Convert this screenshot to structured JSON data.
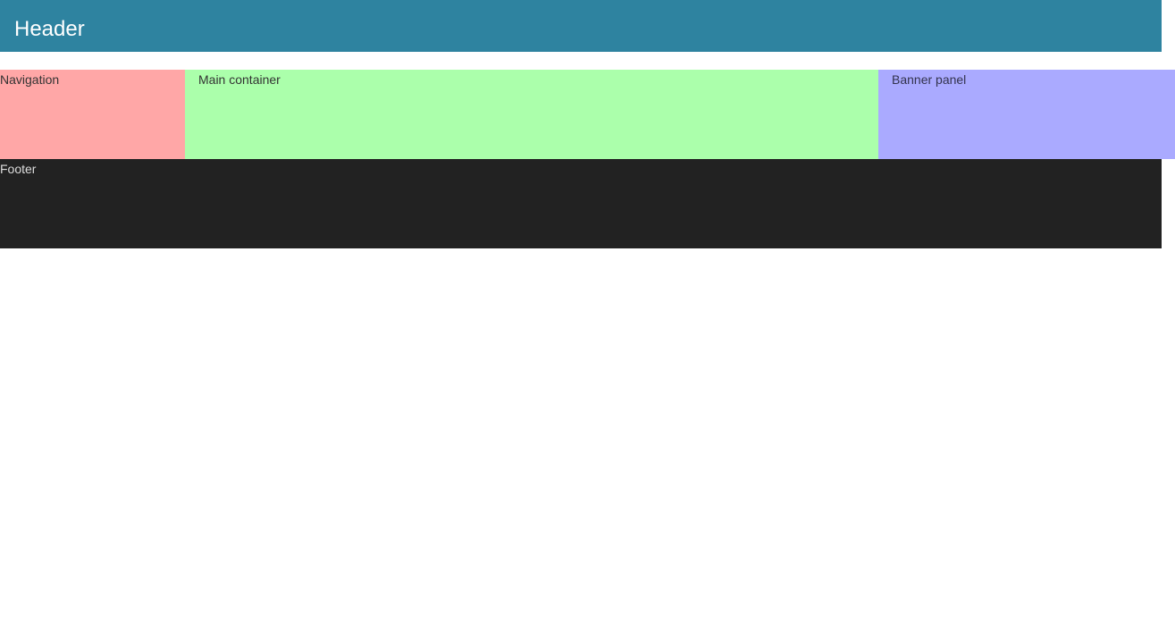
{
  "header": {
    "title": "Header"
  },
  "layout": {
    "navigation_label": "Navigation",
    "main_label": "Main container",
    "banner_label": "Banner panel"
  },
  "footer": {
    "label": "Footer"
  },
  "colors": {
    "header_bg": "#2e83a0",
    "navigation_bg": "#ffa7a7",
    "main_bg": "#abffab",
    "banner_bg": "#aaaaff",
    "footer_bg": "#222222"
  }
}
